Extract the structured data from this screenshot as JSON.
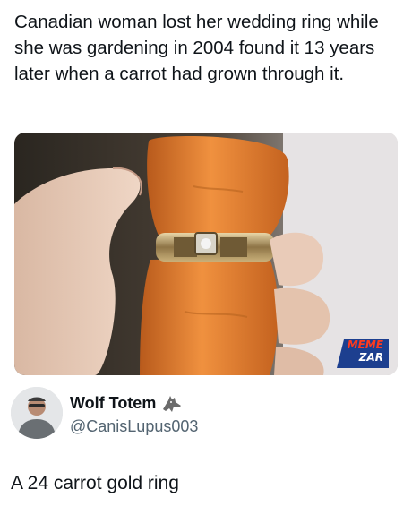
{
  "post": {
    "caption": "Canadian woman lost her wedding ring while she was gardening in 2004 found it 13 years later when a carrot had grown through it."
  },
  "watermark": {
    "line1": "MEME",
    "line2": "ZAR"
  },
  "reply": {
    "display_name": "Wolf Totem",
    "handle": "@CanisLupus003",
    "text": "A 24 carrot gold ring",
    "badge_icon": "wolf-icon"
  },
  "colors": {
    "text": "#0f1419",
    "secondary_text": "#536471",
    "carrot": "#e07a2e",
    "watermark_bg": "#1d3f8f",
    "watermark_text": "#ff3b1f"
  }
}
